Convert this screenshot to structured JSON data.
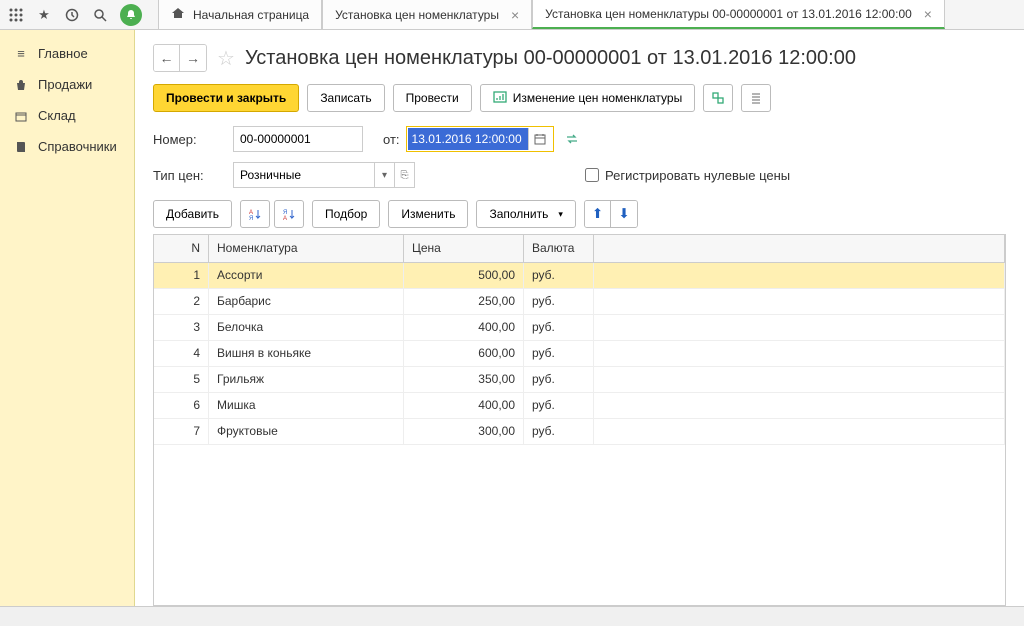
{
  "tabs": {
    "home": "Начальная страница",
    "t1": "Установка цен номенклатуры",
    "t2": "Установка цен номенклатуры 00-00000001 от 13.01.2016 12:00:00"
  },
  "sidebar": {
    "main": "Главное",
    "sales": "Продажи",
    "stock": "Склад",
    "refs": "Справочники"
  },
  "page_title": "Установка цен номенклатуры 00-00000001 от 13.01.2016 12:00:00",
  "actions": {
    "post_close": "Провести и закрыть",
    "save": "Записать",
    "post": "Провести",
    "change_prices": "Изменение цен номенклатуры"
  },
  "labels": {
    "number": "Номер:",
    "from": "от:",
    "price_type": "Тип цен:",
    "register_zero": "Регистрировать нулевые цены"
  },
  "form": {
    "number": "00-00000001",
    "date": "13.01.2016 12:00:00",
    "price_type": "Розничные"
  },
  "toolbar2": {
    "add": "Добавить",
    "select": "Подбор",
    "edit": "Изменить",
    "fill": "Заполнить"
  },
  "grid": {
    "headers": {
      "n": "N",
      "nom": "Номенклатура",
      "price": "Цена",
      "cur": "Валюта"
    },
    "rows": [
      {
        "n": "1",
        "nom": "Ассорти",
        "price": "500,00",
        "cur": "руб."
      },
      {
        "n": "2",
        "nom": "Барбарис",
        "price": "250,00",
        "cur": "руб."
      },
      {
        "n": "3",
        "nom": "Белочка",
        "price": "400,00",
        "cur": "руб."
      },
      {
        "n": "4",
        "nom": "Вишня в коньяке",
        "price": "600,00",
        "cur": "руб."
      },
      {
        "n": "5",
        "nom": "Грильяж",
        "price": "350,00",
        "cur": "руб."
      },
      {
        "n": "6",
        "nom": "Мишка",
        "price": "400,00",
        "cur": "руб."
      },
      {
        "n": "7",
        "nom": "Фруктовые",
        "price": "300,00",
        "cur": "руб."
      }
    ]
  }
}
